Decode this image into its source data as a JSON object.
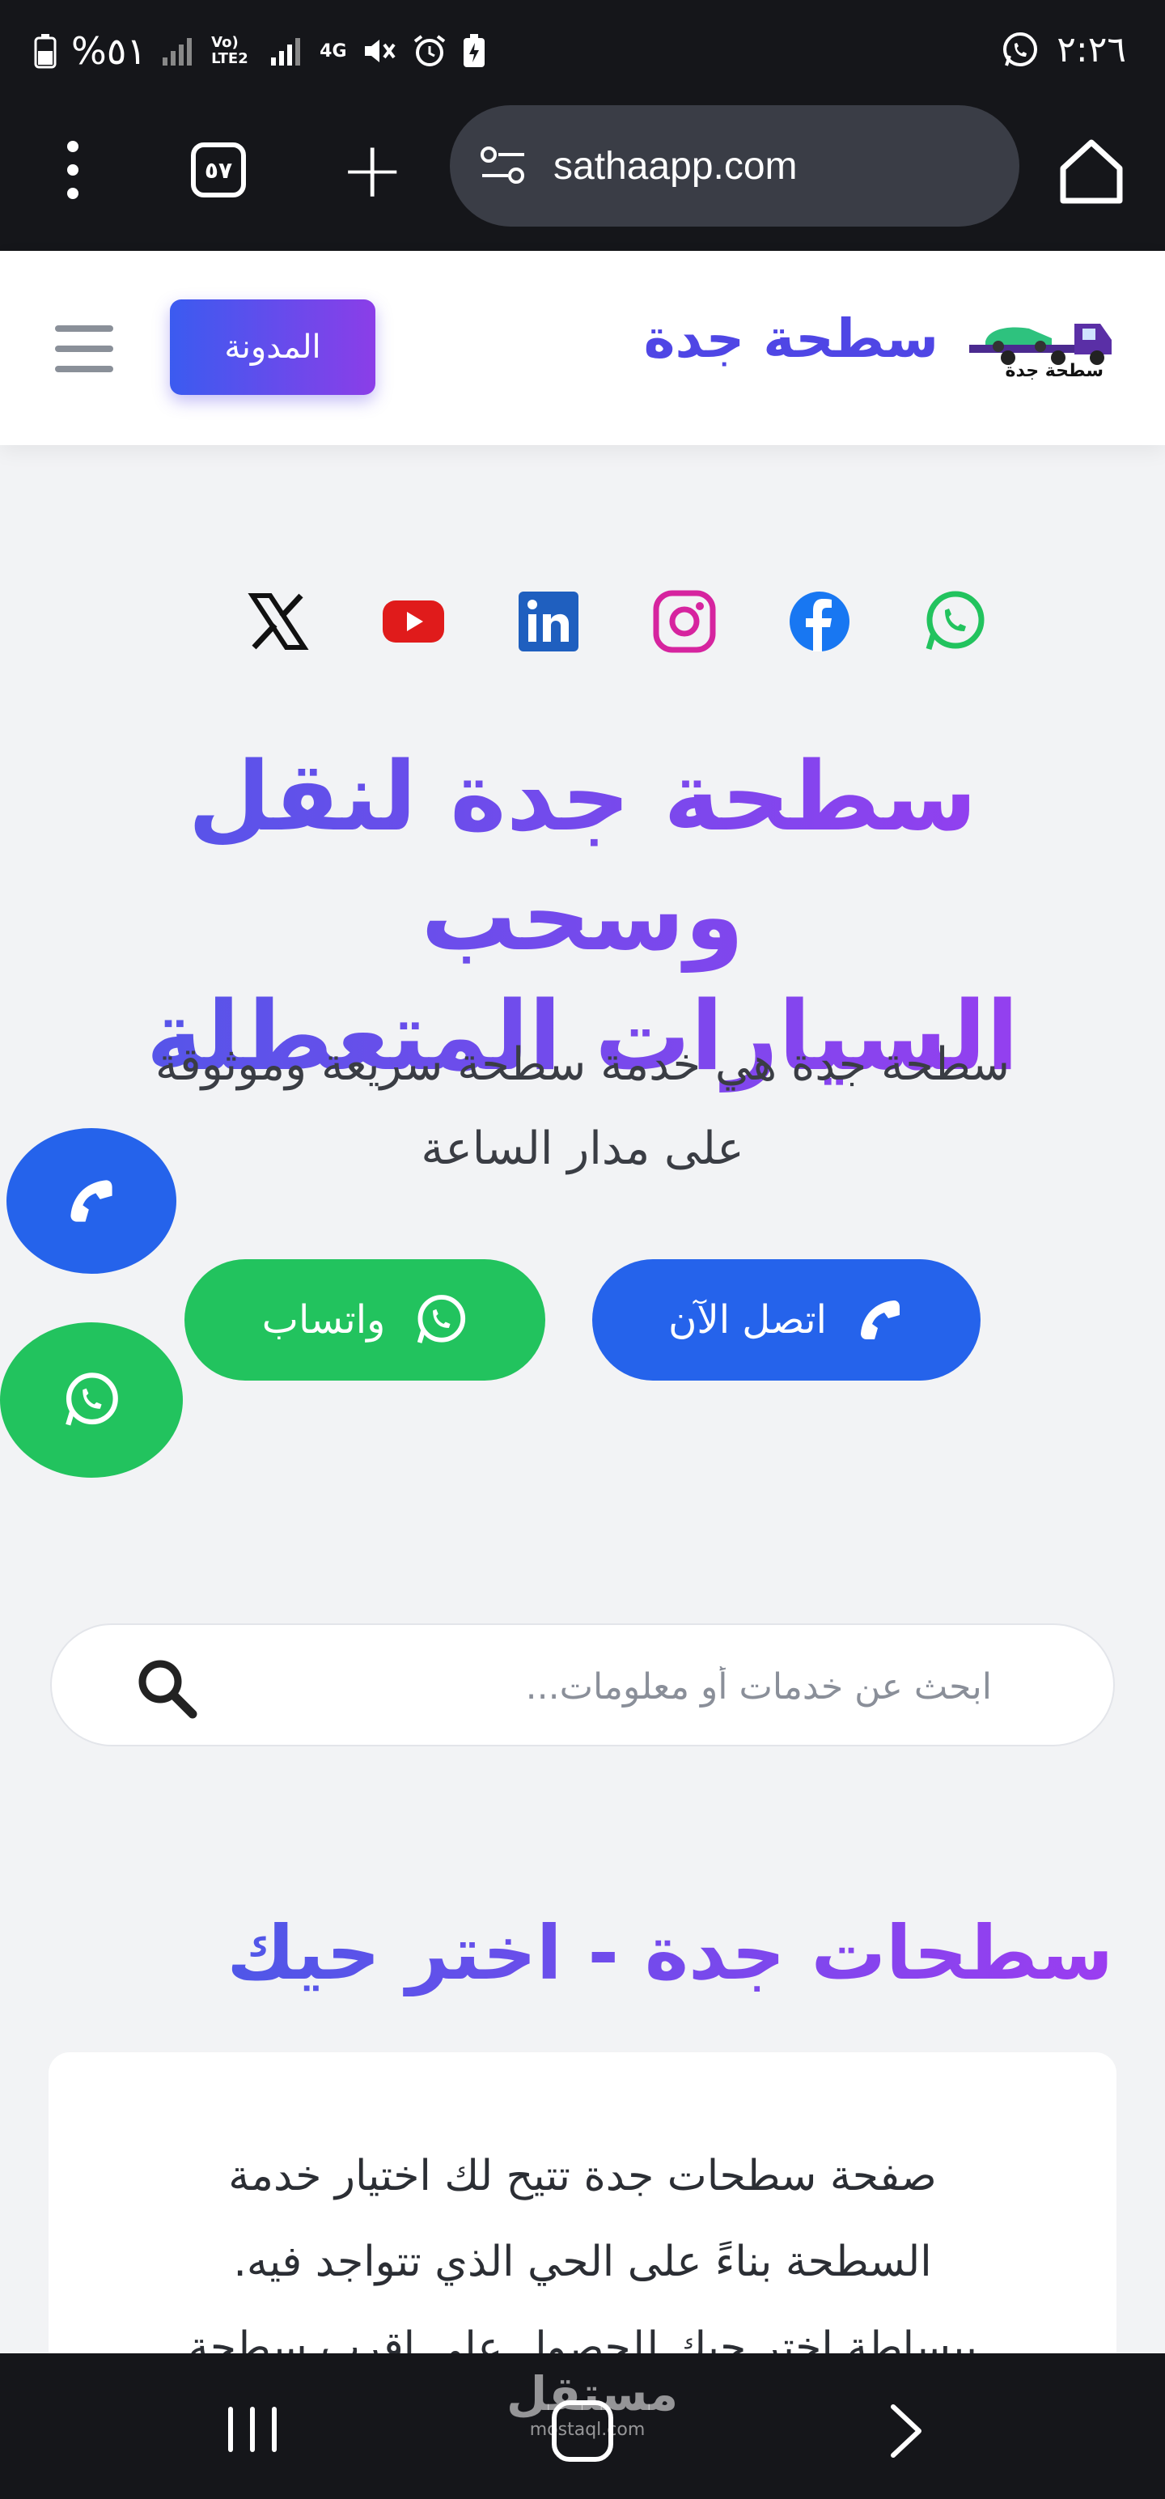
{
  "status_bar": {
    "battery": "%٥١",
    "signal_label": "Vo) LTE2",
    "network": "4G",
    "time": "٢:٢٦",
    "icons": [
      "battery-icon",
      "signal-icon",
      "signal-icon",
      "mute-icon",
      "alarm-icon",
      "battery-saver-icon",
      "whatsapp-notification-icon"
    ]
  },
  "browser": {
    "tab_count": "٥٧",
    "url": "sathaapp.com"
  },
  "header": {
    "brand_name": "سطحة جدة",
    "logo_text": "سطحة جدة",
    "blog_button": "المدونة"
  },
  "social": [
    "x-icon",
    "youtube-icon",
    "linkedin-icon",
    "instagram-icon",
    "facebook-icon",
    "whatsapp-icon"
  ],
  "hero": {
    "title_line1": "سطحة جدة لنقل وسحب",
    "title_line2": "السيارات المتعطلة",
    "subtitle_line1": "سطحة جدة هي خدمة سطحة سريعة وموثوقة",
    "subtitle_line2": "على مدار الساعة",
    "call_button": "اتصل الآن",
    "whatsapp_button": "واتساب"
  },
  "search": {
    "placeholder": "ابحث عن خدمات أو معلومات..."
  },
  "section": {
    "title": "سطحات جدة - اختر حيك",
    "card_line1": "صفحة سطحات جدة تتيح لك اختيار خدمة",
    "card_line2": "السطحة بناءً على الحي الذي تتواجد فيه.",
    "card_line3": "ببساطة اختر حيك للحصول على اقرب سطحة"
  },
  "watermark": {
    "main": "مستقل",
    "sub": "mostaql.com"
  },
  "colors": {
    "primary_blue": "#2563eb",
    "whatsapp_green": "#22c35e",
    "gradient_start": "#4f57e8",
    "gradient_end": "#9b3df0"
  }
}
